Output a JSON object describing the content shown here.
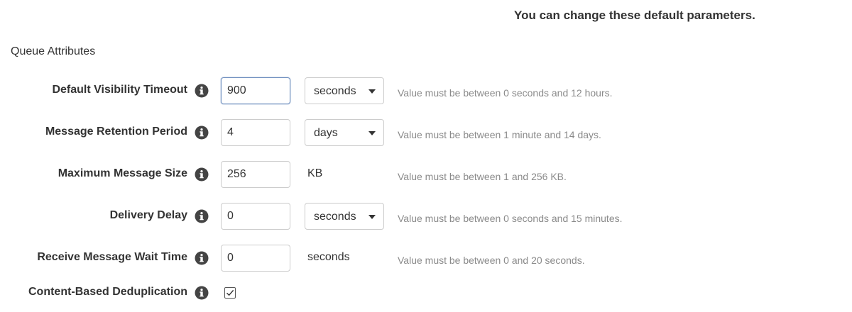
{
  "header_note": "You can change these default parameters.",
  "section_title": "Queue Attributes",
  "icons": {
    "info": "info-circle-icon",
    "dropdown": "caret-down-icon",
    "checkmark": "checkmark-icon"
  },
  "rows": {
    "visibility_timeout": {
      "label": "Default Visibility Timeout",
      "value": "900",
      "unit": "seconds",
      "help": "Value must be between 0 seconds and 12 hours."
    },
    "retention_period": {
      "label": "Message Retention Period",
      "value": "4",
      "unit": "days",
      "help": "Value must be between 1 minute and 14 days."
    },
    "max_message_size": {
      "label": "Maximum Message Size",
      "value": "256",
      "unit": "KB",
      "help": "Value must be between 1 and 256 KB."
    },
    "delivery_delay": {
      "label": "Delivery Delay",
      "value": "0",
      "unit": "seconds",
      "help": "Value must be between 0 seconds and 15 minutes."
    },
    "receive_wait_time": {
      "label": "Receive Message Wait Time",
      "value": "0",
      "unit": "seconds",
      "help": "Value must be between 0 and 20 seconds."
    },
    "content_dedup": {
      "label": "Content-Based Deduplication",
      "checked": true
    }
  },
  "colors": {
    "text": "#333333",
    "help_text": "#8a8a8a",
    "input_border": "#cccccc",
    "focus_border": "#6f8fbf",
    "icon": "#444444"
  }
}
